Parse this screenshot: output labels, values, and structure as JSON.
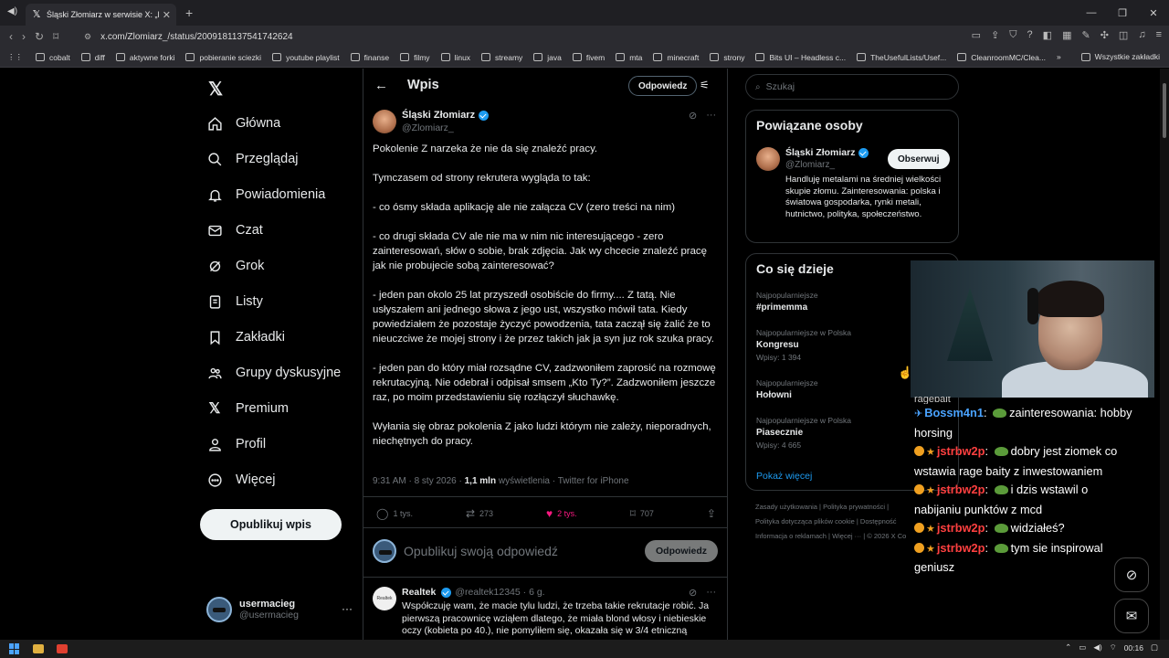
{
  "browser": {
    "tab_title": "Śląski Złomiarz w serwisie X: „Po...",
    "url": "x.com/Zlomiarz_/status/2009181137541742624",
    "bookmarks": [
      "cobalt",
      "diff",
      "aktywne forki",
      "pobieranie sciezki",
      "youtube playlist",
      "finanse",
      "filmy",
      "linux",
      "streamy",
      "java",
      "fivem",
      "mta",
      "minecraft",
      "strony",
      "Bits UI – Headless c...",
      "TheUsefulLists/Usef...",
      "CleanroomMC/Clea..."
    ],
    "bookmarks_all": "Wszystkie zakładki"
  },
  "nav": {
    "items": [
      {
        "label": "Główna",
        "icon": "home-icon"
      },
      {
        "label": "Przeglądaj",
        "icon": "search-icon"
      },
      {
        "label": "Powiadomienia",
        "icon": "bell-icon"
      },
      {
        "label": "Czat",
        "icon": "mail-icon"
      },
      {
        "label": "Grok",
        "icon": "grok-icon"
      },
      {
        "label": "Listy",
        "icon": "list-icon"
      },
      {
        "label": "Zakładki",
        "icon": "bookmark-icon"
      },
      {
        "label": "Grupy dyskusyjne",
        "icon": "communities-icon"
      },
      {
        "label": "Premium",
        "icon": "x-logo-icon"
      },
      {
        "label": "Profil",
        "icon": "profile-icon"
      },
      {
        "label": "Więcej",
        "icon": "more-circle-icon"
      }
    ],
    "post_button": "Opublikuj wpis",
    "user_name": "usermacieg",
    "user_handle": "@usermacieg"
  },
  "header": {
    "title": "Wpis",
    "reply_button": "Odpowiedz"
  },
  "post": {
    "author_name": "Śląski Złomiarz",
    "author_handle": "@Zlomiarz_",
    "paragraphs": [
      "Pokolenie Z narzeka że nie da się znaleźć pracy.",
      "Tymczasem od strony rekrutera wygląda to tak:",
      "- co ósmy składa aplikację ale nie załącza CV (zero treści na nim)",
      "- co drugi składa CV ale nie ma w nim nic interesującego - zero zainteresowań, słów o sobie, brak zdjęcia. Jak wy chcecie znaleźć pracę jak nie probujecie sobą zainteresować?",
      "- jeden pan okolo 25 lat przyszedł osobiście do firmy.... Z tatą. Nie usłyszałem ani jednego słowa z jego ust, wszystko mówił tata. Kiedy powiedziałem że pozostaje życzyć powodzenia, tata zaczął się żalić że to nieuczciwe że mojej strony i że przez takich jak ja syn juz rok szuka pracy.",
      "- jeden pan do który miał rozsądne CV, zadzwoniłem zaprosić na rozmowę rekrutacyjną. Nie odebrał i odpisał smsem „Kto Ty?”. Zadzwoniłem jeszcze raz, po moim przedstawieniu się rozłączył słuchawkę.",
      "Wyłania się obraz pokolenia Z jako ludzi którym nie zależy, nieporadnych, niechętnych do pracy."
    ],
    "time": "9:31 AM · 8 sty 2026 · ",
    "views": "1,1 mln",
    "views_label": " wyświetlenia · Twitter for iPhone",
    "replies": "1 tys.",
    "reposts": "273",
    "likes": "2 tys.",
    "bookmarks": "707"
  },
  "compose": {
    "placeholder": "Opublikuj swoją odpowiedź",
    "button": "Odpowiedz"
  },
  "reply": {
    "name": "Realtek",
    "handle": "@realtek12345 · 6 g.",
    "avatar_text": "Realtek",
    "text": "Współczuję wam, że macie tylu ludzi, że trzeba takie rekrutacje robić. Ja pierwszą pracownicę wziąłem dlatego, że miała blond włosy i niebieskie oczy (kobieta po 40.), nie pomyliłem się, okazała się w 3/4 etniczną"
  },
  "right": {
    "search_placeholder": "Szukaj",
    "related_title": "Powiązane osoby",
    "related_name": "Śląski Złomiarz",
    "related_handle": "@Zlomiarz_",
    "follow_button": "Obserwuj",
    "related_bio": "Handluję metalami na średniej wielkości skupie złomu. Zainteresowania: polska i światowa gospodarka, rynki metali, hutnictwo, polityka, społeczeństwo.",
    "trends_title": "Co się dzieje",
    "trends": [
      {
        "cat": "Najpopularniejsze",
        "name": "#primemma",
        "count": ""
      },
      {
        "cat": "Najpopularniejsze w Polska",
        "name": "Kongresu",
        "count": "Wpisy: 1 394"
      },
      {
        "cat": "Najpopularniejsze",
        "name": "Hołowni",
        "count": ""
      },
      {
        "cat": "Najpopularniejsze w Polska",
        "name": "Piasecznie",
        "count": "Wpisy: 4 665"
      }
    ],
    "show_more": "Pokaż więcej",
    "footer1": "Zasady użytkowania  |  Polityka prywatności  |",
    "footer2": "Polityka dotycząca plików cookie  |  Dostępność",
    "footer3": "Informacja o reklamach  |  Więcej ···  |  © 2026 X Co"
  },
  "chat": {
    "fragment": "ragebait",
    "messages": [
      {
        "user": "Bossm4n1",
        "text": "zainteresowania: hobby horsing"
      },
      {
        "user": "jstrbw2p",
        "text": "dobry jest ziomek co wstawia rage baity z inwestowaniem"
      },
      {
        "user": "jstrbw2p",
        "text": "i dzis wstawil o nabijaniu punktów z mcd"
      },
      {
        "user": "jstrbw2p",
        "text": "widziałeś?"
      },
      {
        "user": "jstrbw2p",
        "text": "tym sie inspirowal geniusz"
      }
    ]
  },
  "taskbar": {
    "time": "00:16"
  }
}
